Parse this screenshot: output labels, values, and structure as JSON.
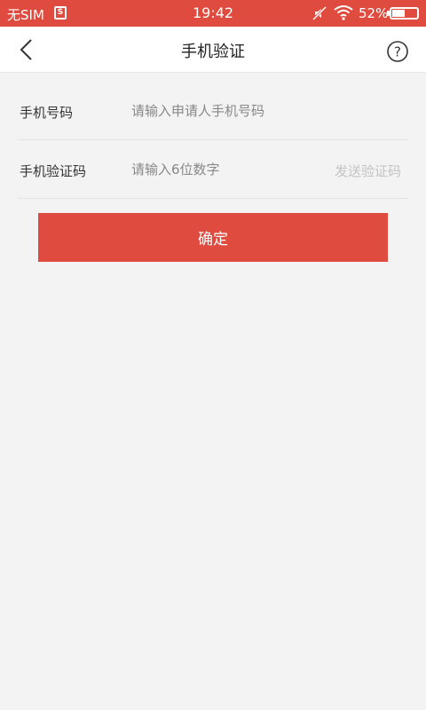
{
  "status_bar": {
    "carrier": "无SIM",
    "sim_icon_glyph": "S",
    "time": "19:42",
    "battery_percent_text": "52%",
    "battery_level": 0.52,
    "icons": [
      "sim-card-icon",
      "mute-icon",
      "wifi-icon",
      "battery-icon"
    ]
  },
  "nav": {
    "title": "手机验证",
    "back_icon": "chevron-left-icon",
    "help_icon": "help-circle-icon",
    "help_glyph": "?"
  },
  "form": {
    "phone": {
      "label": "手机号码",
      "value": "",
      "placeholder": "请输入申请人手机号码"
    },
    "code": {
      "label": "手机验证码",
      "value": "",
      "placeholder": "请输入6位数字",
      "send_label": "发送验证码"
    }
  },
  "actions": {
    "confirm_label": "确定"
  },
  "colors": {
    "accent": "#df4b3e",
    "background": "#f3f3f3",
    "disabled_text": "#c3c3c3"
  }
}
